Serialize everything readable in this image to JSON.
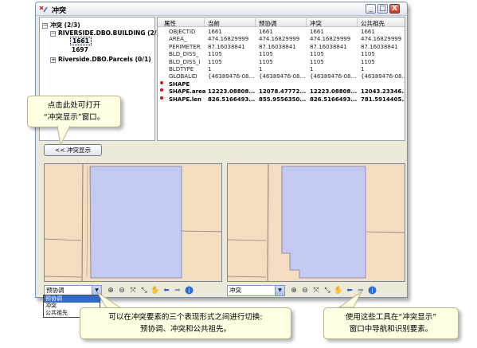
{
  "window": {
    "title": "冲突",
    "min_label": "_",
    "max_label": "□",
    "close_label": "X"
  },
  "tree": {
    "root": "冲突 (2/3)",
    "items": [
      {
        "label": "RIVERSIDE.DBO.BUILDING (2/2)",
        "expanded": true
      },
      {
        "label": "1661",
        "selected": true
      },
      {
        "label": "1697",
        "selected": false
      },
      {
        "label": "Riverside.DBO.Parcels (0/1)",
        "expanded": false
      }
    ]
  },
  "grid": {
    "columns": [
      "属性",
      "当前",
      "预协调",
      "冲突",
      "公共祖先"
    ],
    "rows": [
      {
        "conflict": false,
        "cells": [
          "OBJECTID",
          "1661",
          "1661",
          "1661",
          "1661"
        ]
      },
      {
        "conflict": false,
        "cells": [
          "AREA_",
          "474.16829999",
          "474.16829999",
          "474.16829999",
          "474.16829999"
        ]
      },
      {
        "conflict": false,
        "cells": [
          "PERIMETER",
          "87.16038841",
          "87.16038841",
          "87.16038841",
          "87.16038841"
        ]
      },
      {
        "conflict": false,
        "cells": [
          "BLD_DISS_",
          "1105",
          "1105",
          "1105",
          "1105"
        ]
      },
      {
        "conflict": false,
        "cells": [
          "BLD_DISS_I",
          "1105",
          "1105",
          "1105",
          "1105"
        ]
      },
      {
        "conflict": false,
        "cells": [
          "BLDTYPE",
          "1",
          "1",
          "1",
          "1"
        ]
      },
      {
        "conflict": false,
        "cells": [
          "GLOBALID",
          "{46389476-08...",
          "{46389476-08...",
          "{46389476-08...",
          "{46389476-08..."
        ]
      },
      {
        "conflict": true,
        "cells": [
          "SHAPE",
          "",
          "",
          "",
          ""
        ]
      },
      {
        "conflict": true,
        "cells": [
          "SHAPE.area",
          "12223.08808...",
          "12078.47772...",
          "12223.08808...",
          "12043.23346..."
        ]
      },
      {
        "conflict": true,
        "cells": [
          "SHAPE.len",
          "826.5166493...",
          "855.9556350...",
          "826.5166493...",
          "781.5914405..."
        ]
      }
    ]
  },
  "display_button": "<< 冲突显示",
  "left_toolbar": {
    "select_value": "预协调",
    "icons": [
      "zoom-in-icon",
      "zoom-out-icon",
      "fixed-zoom-in-icon",
      "fixed-zoom-out-icon",
      "pan-icon",
      "back-icon",
      "forward-icon",
      "identify-icon"
    ]
  },
  "right_toolbar": {
    "select_value": "冲突"
  },
  "dropdown_options": [
    "预协调",
    "冲突",
    "公共祖先"
  ],
  "callouts": {
    "open_display_line1": "点击此处可打开",
    "open_display_line2": "“冲突显示”窗口。",
    "switch_forms_line1": "可以在冲突要素的三个表现形式之间进行切换:",
    "switch_forms_line2": "预协调、冲突和公共祖先。",
    "tools_line1": "使用这些工具在“冲突显示”",
    "tools_line2": "窗口中导航和识别要素。"
  },
  "colors": {
    "parcel_fill": "#f4dcc0",
    "building_fill": "#c4c9f2",
    "building_stroke": "#7b7ba8",
    "conflict_dot": "#d21414"
  }
}
